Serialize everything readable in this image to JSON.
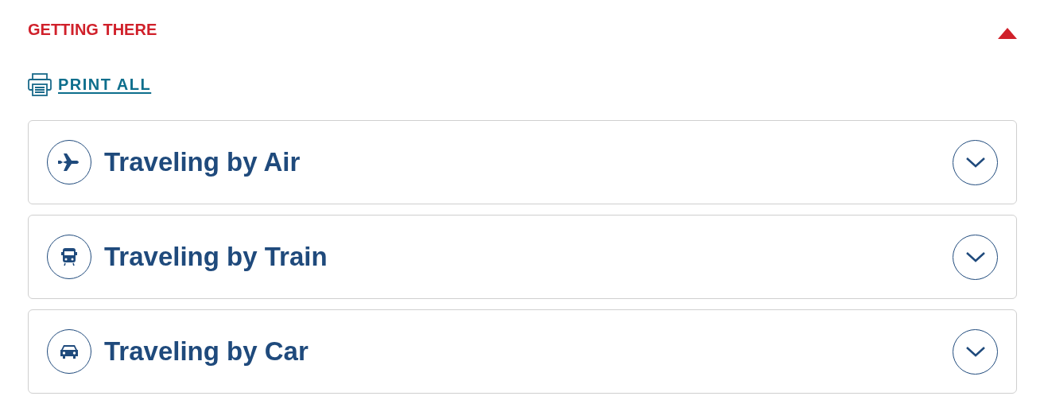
{
  "section": {
    "title": "GETTING THERE",
    "expanded": true
  },
  "print_link": "PRINT ALL",
  "items": [
    {
      "kind": "air",
      "title": "Traveling by Air",
      "expanded": false
    },
    {
      "kind": "train",
      "title": "Traveling by Train",
      "expanded": false
    },
    {
      "kind": "car",
      "title": "Traveling by Car",
      "expanded": false
    }
  ]
}
